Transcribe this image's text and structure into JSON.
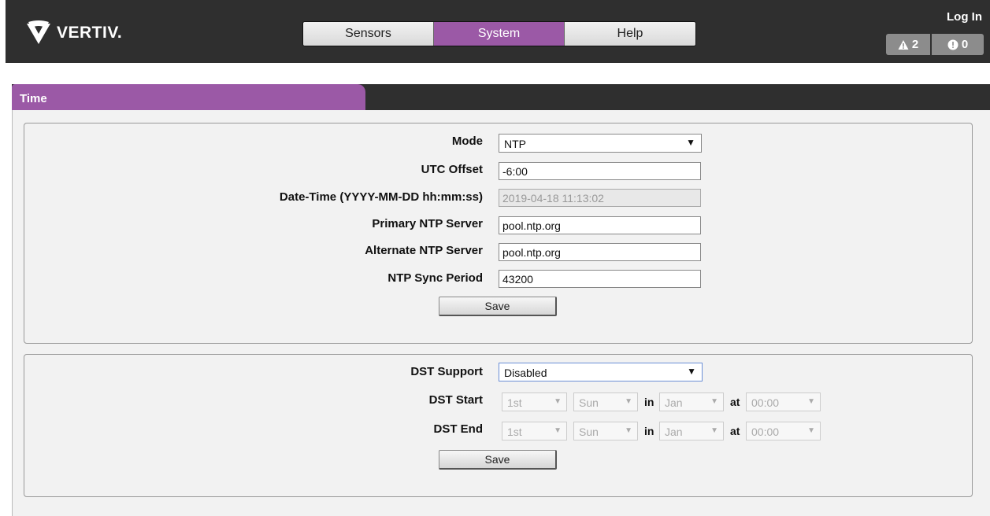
{
  "header": {
    "brand": "VERTIV.",
    "nav": [
      {
        "label": "Sensors",
        "active": false
      },
      {
        "label": "System",
        "active": true
      },
      {
        "label": "Help",
        "active": false
      }
    ],
    "login_label": "Log In",
    "warning_count": "2",
    "info_count": "0"
  },
  "section": {
    "title": "Time"
  },
  "time_form": {
    "mode_label": "Mode",
    "mode_value": "NTP",
    "utc_label": "UTC Offset",
    "utc_value": "-6:00",
    "datetime_label": "Date-Time (YYYY-MM-DD hh:mm:ss)",
    "datetime_value": "2019-04-18 11:13:02",
    "primary_label": "Primary NTP Server",
    "primary_value": "pool.ntp.org",
    "alternate_label": "Alternate NTP Server",
    "alternate_value": "pool.ntp.org",
    "sync_label": "NTP Sync Period",
    "sync_value": "43200",
    "save_label": "Save"
  },
  "dst_form": {
    "support_label": "DST Support",
    "support_value": "Disabled",
    "start_label": "DST Start",
    "end_label": "DST End",
    "start": {
      "week": "1st",
      "day": "Sun",
      "month": "Jan",
      "time": "00:00"
    },
    "end": {
      "week": "1st",
      "day": "Sun",
      "month": "Jan",
      "time": "00:00"
    },
    "in_word": "in",
    "at_word": "at",
    "save_label": "Save"
  },
  "colors": {
    "header_bg": "#2f2f2f",
    "accent": "#9b59a6",
    "badge_bg": "#8c8c8c",
    "panel_bg": "#f2f2f2"
  },
  "icons": {
    "logo": "vertiv-chevron-logo",
    "warning": "warning-triangle-icon",
    "info": "info-circle-icon",
    "dropdown": "dropdown-arrow-icon"
  }
}
